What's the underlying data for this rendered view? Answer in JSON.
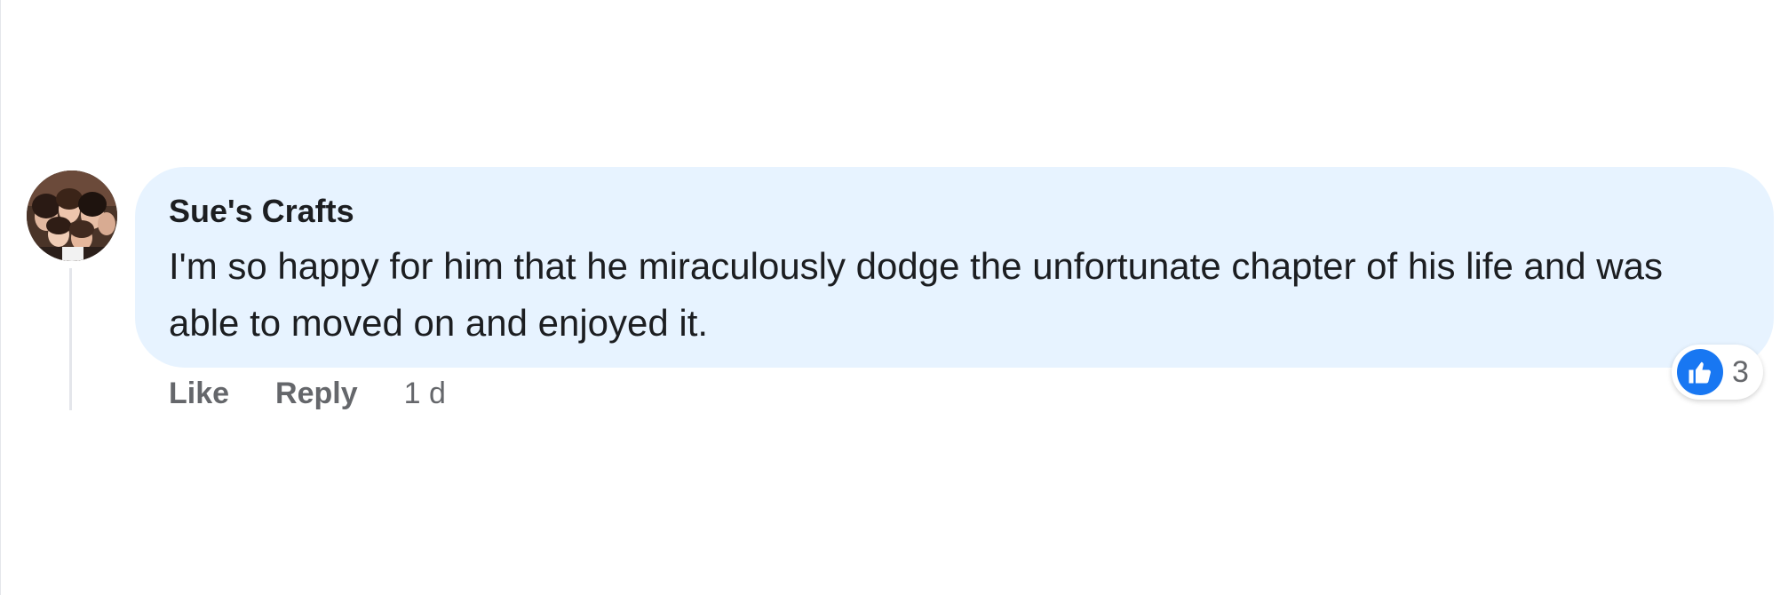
{
  "comment": {
    "author": "Sue's Crafts",
    "text": "I'm so happy for him that he miraculously dodge the unfortunate chapter of his life and was able to moved on and enjoyed it.",
    "actions": {
      "like_label": "Like",
      "reply_label": "Reply",
      "timestamp": "1 d"
    },
    "reactions": {
      "icon": "thumbs-up-icon",
      "count": "3"
    }
  },
  "colors": {
    "bubble_bg": "#e7f3ff",
    "like_blue": "#1877f2",
    "secondary_text": "#65676b",
    "primary_text": "#1c1e21"
  }
}
